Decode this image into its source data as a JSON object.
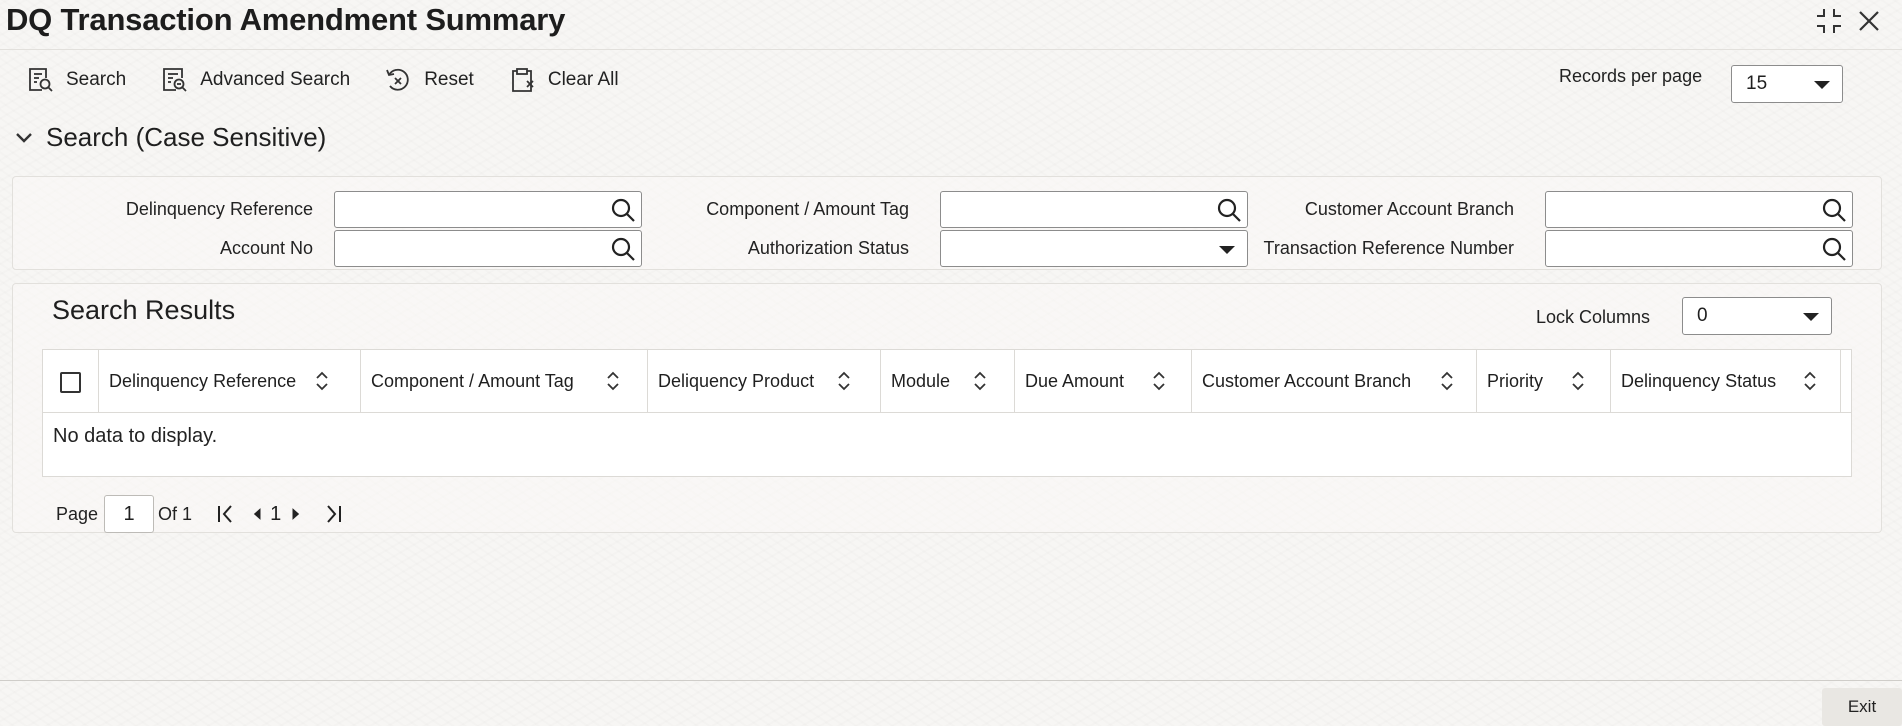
{
  "window": {
    "title": "DQ Transaction Amendment Summary",
    "minimize_icon": "collapse-icon",
    "close_icon": "close-icon"
  },
  "toolbar": {
    "search_label": "Search",
    "advanced_search_label": "Advanced Search",
    "reset_label": "Reset",
    "clear_all_label": "Clear All",
    "records_per_page_label": "Records per page",
    "records_per_page_value": "15"
  },
  "search_section": {
    "title": "Search (Case Sensitive)",
    "fields": {
      "delinquency_reference": {
        "label": "Delinquency Reference",
        "value": ""
      },
      "component_amount_tag": {
        "label": "Component / Amount Tag",
        "value": ""
      },
      "customer_account_branch": {
        "label": "Customer Account Branch",
        "value": ""
      },
      "account_no": {
        "label": "Account No",
        "value": ""
      },
      "authorization_status": {
        "label": "Authorization Status",
        "value": ""
      },
      "transaction_reference_number": {
        "label": "Transaction Reference Number",
        "value": ""
      }
    }
  },
  "results": {
    "title": "Search Results",
    "lock_columns_label": "Lock Columns",
    "lock_columns_value": "0",
    "columns": [
      "Delinquency Reference",
      "Component / Amount Tag",
      "Deliquency Product",
      "Module",
      "Due Amount",
      "Customer Account Branch",
      "Priority",
      "Delinquency Status"
    ],
    "empty_message": "No data to display."
  },
  "pagination": {
    "page_label": "Page",
    "current_page": "1",
    "of_label": "Of 1",
    "page_number": "1"
  },
  "footer": {
    "exit_label": "Exit"
  }
}
